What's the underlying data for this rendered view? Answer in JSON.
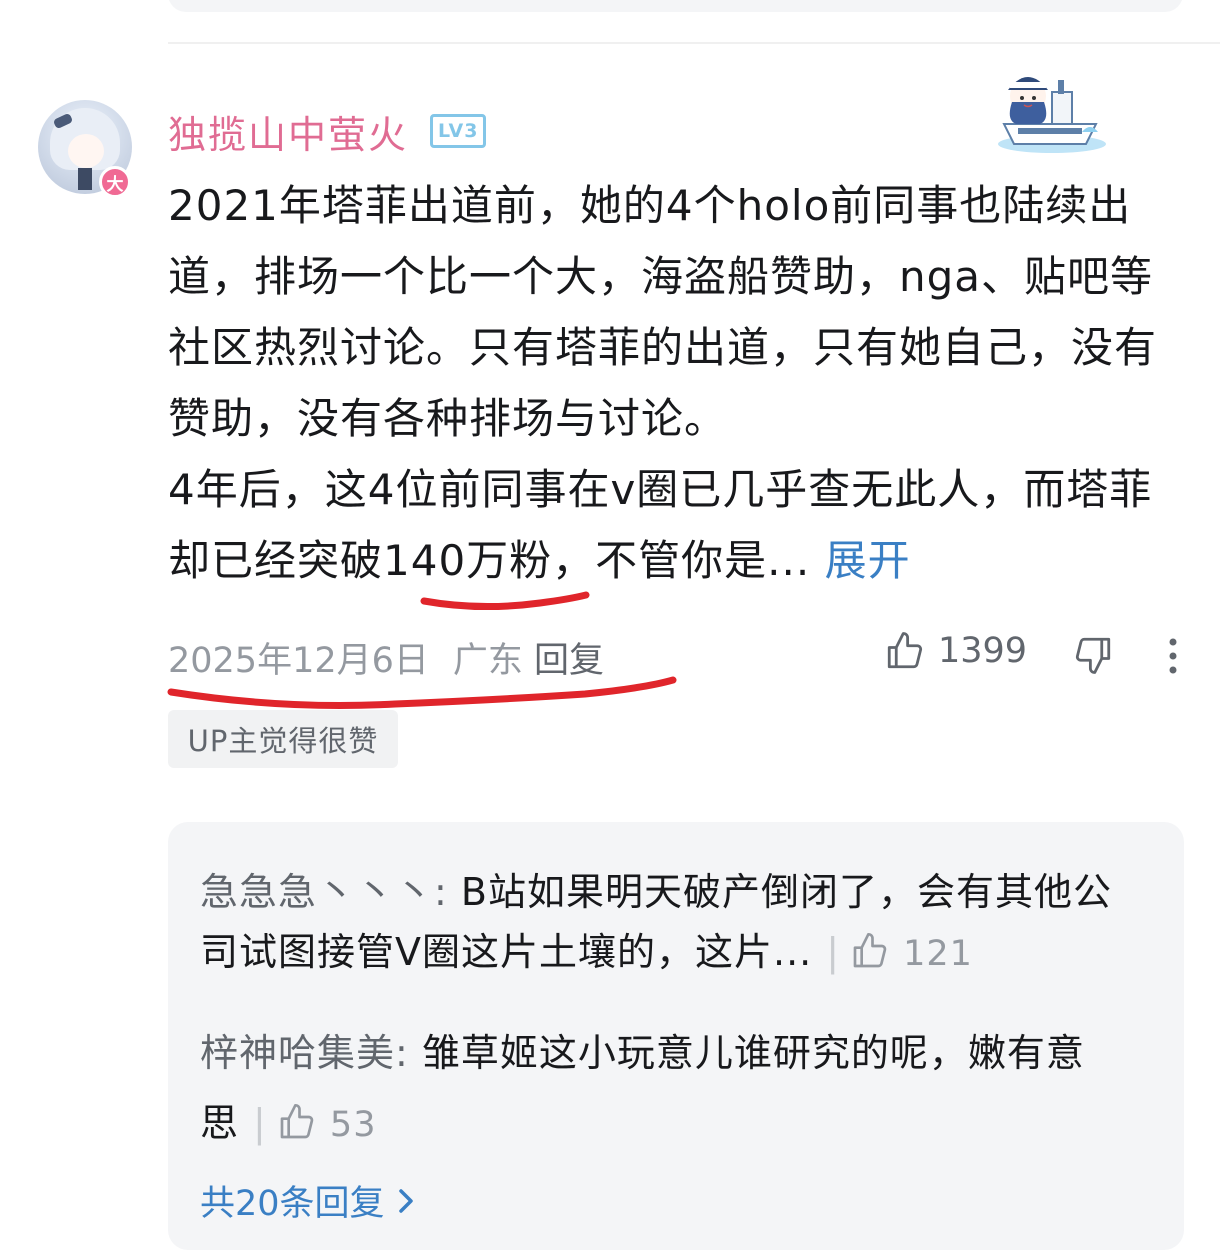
{
  "comment": {
    "username": "独揽山中萤火",
    "level": "LV3",
    "avatar_badge": "大",
    "text_lines": [
      "2021年塔菲出道前，她的4个holo前同事也陆续出道，排场一个比一个大，海盗船赞助，nga、贴吧等社区热烈讨论。只有塔菲的出道，只有她自己，没有赞助，没有各种排场与讨论。",
      "4年后，这4位前同事在v圈已几乎查无此人，而塔菲却已经突破140万粉，不管你是..."
    ],
    "expand_label": "展开",
    "date": "2025年12月6日",
    "location": "广东",
    "reply_label": "回复",
    "like_count": "1399",
    "up_tag": "UP主觉得很赞"
  },
  "replies": {
    "items": [
      {
        "user": "急急急丶丶丶",
        "text": "B站如果明天破产倒闭了，会有其他公司试图接管V圈这片土壤的，这片...",
        "likes": "121"
      },
      {
        "user": "梓神哈集美",
        "text": "雏草姬这小玩意儿谁研究的呢，嫩有意思",
        "likes": "53"
      }
    ],
    "total_label": "共20条回复"
  },
  "colors": {
    "username": "#e06c93",
    "link": "#3a7fc4",
    "annotation_red": "#e0252b",
    "level_badge": "#83c6e8"
  }
}
